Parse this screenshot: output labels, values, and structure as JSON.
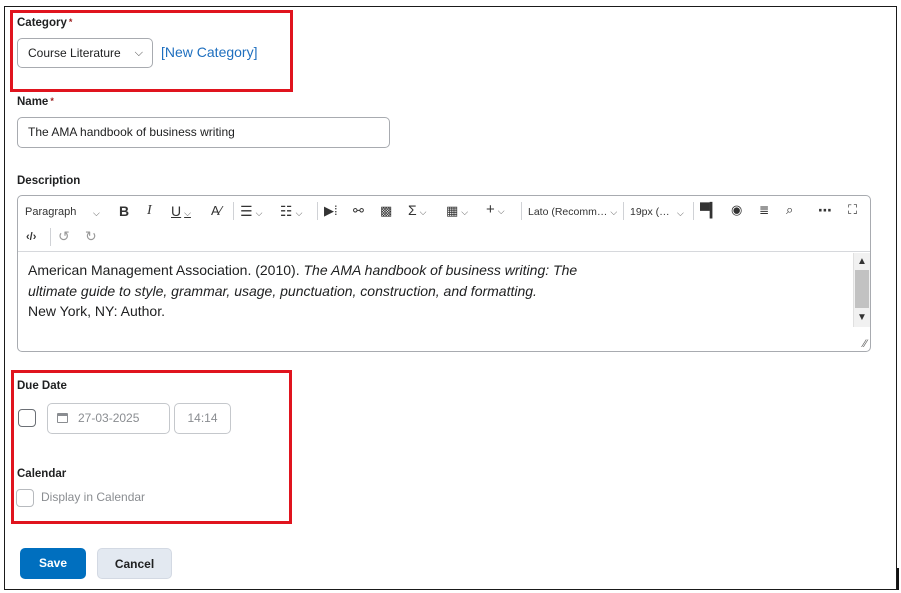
{
  "category": {
    "label": "Category",
    "required_mark": "*",
    "selected": "Course Literature",
    "new_link": "[New Category]"
  },
  "name": {
    "label": "Name",
    "required_mark": "*",
    "value": "The AMA handbook of business writing"
  },
  "description": {
    "label": "Description",
    "toolbar": {
      "paragraph": "Paragraph",
      "bold": "B",
      "italic": "I",
      "underline": "U",
      "font": "Lato (Recomm…",
      "size": "19px (…"
    },
    "content": {
      "line1_plain": "American Management Association. (2010). ",
      "line1_italic": "The AMA handbook of business writing: The",
      "line2_italic": "ultimate guide to style, grammar, usage, punctuation, construction, and formatting.",
      "line3_plain": "New York, NY: Author."
    }
  },
  "due_date": {
    "label": "Due Date",
    "date_value": "27-03-2025",
    "time_value": "14:14"
  },
  "calendar": {
    "label": "Calendar",
    "checkbox_label": "Display in Calendar"
  },
  "buttons": {
    "save": "Save",
    "cancel": "Cancel"
  },
  "colors": {
    "accent": "#006fbf",
    "link": "#1e6fbf",
    "highlight": "#e0141e"
  },
  "icons": [
    "chevron-down-icon",
    "bold-icon",
    "italic-icon",
    "underline-icon",
    "spellcheck-icon",
    "align-icon",
    "list-icon",
    "media-icon",
    "link-icon",
    "image-icon",
    "sigma-icon",
    "table-icon",
    "plus-icon",
    "format-painter-icon",
    "accessibility-icon",
    "word-count-icon",
    "preview-icon",
    "more-icon",
    "fullscreen-icon",
    "source-code-icon",
    "undo-icon",
    "redo-icon",
    "calendar-icon",
    "resize-handle-icon"
  ]
}
